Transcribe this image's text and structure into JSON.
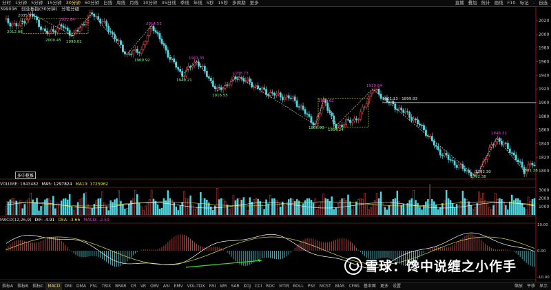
{
  "toolbar": {
    "timeframes": [
      "分时",
      "1分钟",
      "5分钟",
      "15分钟",
      "30分钟",
      "60分钟",
      "日线",
      "周线",
      "月线",
      "10分钟",
      "45日线",
      "季线",
      "年线",
      "5秒",
      "15秒",
      "多周期",
      "更多"
    ],
    "active": "30分钟",
    "right": [
      "直播",
      "叠加",
      "统计",
      "画线",
      "F10",
      "标记",
      "-",
      "自选"
    ]
  },
  "title": {
    "code": "399006",
    "name": "创业板指(30分钟)",
    "indicator": "分笔分级"
  },
  "stamp": "多中枢推",
  "price_axis": [
    "2020",
    "2000",
    "1980",
    "1960",
    "1940",
    "1920",
    "1900",
    "1880",
    "1860",
    "1840",
    "1820",
    "1800"
  ],
  "volume_axis": [
    "3000",
    "2000",
    "1000"
  ],
  "macd_axis": [
    "10.00",
    "0.00",
    "-10.00"
  ],
  "time_axis": [
    "11:30",
    "13:30",
    "14:30",
    "10:30",
    "11:30",
    "13:30",
    "14:30",
    "10:30",
    "11:30",
    "14:00",
    "10:00",
    "11:00",
    "14:00",
    "10:00",
    "11:00",
    "14:00",
    "10:00",
    "11:00",
    "14:00",
    "10:00"
  ],
  "price_labels": {
    "top_left_high": "2035.91",
    "p2012": "2012.06",
    "p2022": "2022.84",
    "p2000": "2000.45",
    "p1998": "1998.02",
    "p2014": "2014.53",
    "p1969": "1969.92",
    "p1961": "1961.35",
    "p1940": "1940.21",
    "p1938": "1938.73",
    "p1916": "1916.55",
    "p1906": "1906.62",
    "p1866": "1866.90",
    "p1864": "1864.24",
    "p1919": "1919.64",
    "range": "1901.13 - 1899.93",
    "p1848": "1848.32",
    "p1792a": "1792.30",
    "p1792b": "1792.38",
    "p1801": "1801.38"
  },
  "volume_info": {
    "label": "VOLUME: 1843482",
    "ma5": "MA5: 1297824",
    "ma10": "MA10: 1725962"
  },
  "macd_info": {
    "label": "MACD(12,26,9)",
    "dif": "DIF: -4.91",
    "dea": "DEA: -3.66",
    "macd": "MACD: -2.50"
  },
  "bottom_tabs": [
    "指标A",
    "指标B",
    "指标C",
    "MACD",
    "DMI",
    "DMA",
    "FSL",
    "TRIX",
    "BRAR",
    "CR",
    "VR",
    "OBV",
    "ASI",
    "EMV",
    "VOL-TDX",
    "RSI",
    "WR",
    "SAR",
    "KDJ",
    "CCI",
    "ROC",
    "MTM",
    "BOLL",
    "PSY",
    "MCST",
    "BIAS",
    "CFBS",
    "基本面",
    "更多",
    "设置"
  ],
  "bottom_active": "MACD",
  "bottom_right": [
    "缩放",
    "平移",
    "显示"
  ],
  "watermark": "雪球：馋中说缠之小作手",
  "colors": {
    "up": "#e04a4a",
    "down": "#4fd6e0",
    "pivot_high": "#e040e0",
    "pivot_low": "#7fff7f",
    "box": "#d8d840",
    "macd_arrow": "#30e030"
  }
}
